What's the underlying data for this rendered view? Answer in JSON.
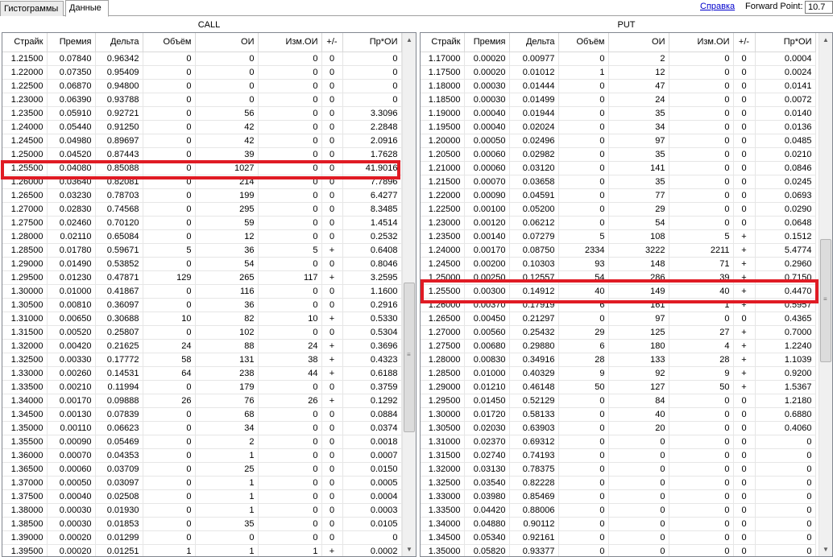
{
  "tabs": [
    {
      "label": "Гистограммы",
      "active": false
    },
    {
      "label": "Данные",
      "active": true
    }
  ],
  "toolbar": {
    "help_link": "Справка",
    "forward_point_label": "Forward Point:",
    "forward_point_value": "10.7"
  },
  "call": {
    "title": "CALL",
    "columns": [
      "Страйк",
      "Премия",
      "Дельта",
      "Объём",
      "ОИ",
      "Изм.ОИ",
      "+/-",
      "Пр*ОИ"
    ],
    "highlighted_strike": "1.25500",
    "rows": [
      [
        "1.21500",
        "0.07840",
        "0.96342",
        "0",
        "0",
        "0",
        "0",
        "0"
      ],
      [
        "1.22000",
        "0.07350",
        "0.95409",
        "0",
        "0",
        "0",
        "0",
        "0"
      ],
      [
        "1.22500",
        "0.06870",
        "0.94800",
        "0",
        "0",
        "0",
        "0",
        "0"
      ],
      [
        "1.23000",
        "0.06390",
        "0.93788",
        "0",
        "0",
        "0",
        "0",
        "0"
      ],
      [
        "1.23500",
        "0.05910",
        "0.92721",
        "0",
        "56",
        "0",
        "0",
        "3.3096"
      ],
      [
        "1.24000",
        "0.05440",
        "0.91250",
        "0",
        "42",
        "0",
        "0",
        "2.2848"
      ],
      [
        "1.24500",
        "0.04980",
        "0.89697",
        "0",
        "42",
        "0",
        "0",
        "2.0916"
      ],
      [
        "1.25000",
        "0.04520",
        "0.87443",
        "0",
        "39",
        "0",
        "0",
        "1.7628"
      ],
      [
        "1.25500",
        "0.04080",
        "0.85088",
        "0",
        "1027",
        "0",
        "0",
        "41.9016"
      ],
      [
        "1.26000",
        "0.03640",
        "0.82081",
        "0",
        "214",
        "0",
        "0",
        "7.7896"
      ],
      [
        "1.26500",
        "0.03230",
        "0.78703",
        "0",
        "199",
        "0",
        "0",
        "6.4277"
      ],
      [
        "1.27000",
        "0.02830",
        "0.74568",
        "0",
        "295",
        "0",
        "0",
        "8.3485"
      ],
      [
        "1.27500",
        "0.02460",
        "0.70120",
        "0",
        "59",
        "0",
        "0",
        "1.4514"
      ],
      [
        "1.28000",
        "0.02110",
        "0.65084",
        "0",
        "12",
        "0",
        "0",
        "0.2532"
      ],
      [
        "1.28500",
        "0.01780",
        "0.59671",
        "5",
        "36",
        "5",
        "+",
        "0.6408"
      ],
      [
        "1.29000",
        "0.01490",
        "0.53852",
        "0",
        "54",
        "0",
        "0",
        "0.8046"
      ],
      [
        "1.29500",
        "0.01230",
        "0.47871",
        "129",
        "265",
        "117",
        "+",
        "3.2595"
      ],
      [
        "1.30000",
        "0.01000",
        "0.41867",
        "0",
        "116",
        "0",
        "0",
        "1.1600"
      ],
      [
        "1.30500",
        "0.00810",
        "0.36097",
        "0",
        "36",
        "0",
        "0",
        "0.2916"
      ],
      [
        "1.31000",
        "0.00650",
        "0.30688",
        "10",
        "82",
        "10",
        "+",
        "0.5330"
      ],
      [
        "1.31500",
        "0.00520",
        "0.25807",
        "0",
        "102",
        "0",
        "0",
        "0.5304"
      ],
      [
        "1.32000",
        "0.00420",
        "0.21625",
        "24",
        "88",
        "24",
        "+",
        "0.3696"
      ],
      [
        "1.32500",
        "0.00330",
        "0.17772",
        "58",
        "131",
        "38",
        "+",
        "0.4323"
      ],
      [
        "1.33000",
        "0.00260",
        "0.14531",
        "64",
        "238",
        "44",
        "+",
        "0.6188"
      ],
      [
        "1.33500",
        "0.00210",
        "0.11994",
        "0",
        "179",
        "0",
        "0",
        "0.3759"
      ],
      [
        "1.34000",
        "0.00170",
        "0.09888",
        "26",
        "76",
        "26",
        "+",
        "0.1292"
      ],
      [
        "1.34500",
        "0.00130",
        "0.07839",
        "0",
        "68",
        "0",
        "0",
        "0.0884"
      ],
      [
        "1.35000",
        "0.00110",
        "0.06623",
        "0",
        "34",
        "0",
        "0",
        "0.0374"
      ],
      [
        "1.35500",
        "0.00090",
        "0.05469",
        "0",
        "2",
        "0",
        "0",
        "0.0018"
      ],
      [
        "1.36000",
        "0.00070",
        "0.04353",
        "0",
        "1",
        "0",
        "0",
        "0.0007"
      ],
      [
        "1.36500",
        "0.00060",
        "0.03709",
        "0",
        "25",
        "0",
        "0",
        "0.0150"
      ],
      [
        "1.37000",
        "0.00050",
        "0.03097",
        "0",
        "1",
        "0",
        "0",
        "0.0005"
      ],
      [
        "1.37500",
        "0.00040",
        "0.02508",
        "0",
        "1",
        "0",
        "0",
        "0.0004"
      ],
      [
        "1.38000",
        "0.00030",
        "0.01930",
        "0",
        "1",
        "0",
        "0",
        "0.0003"
      ],
      [
        "1.38500",
        "0.00030",
        "0.01853",
        "0",
        "35",
        "0",
        "0",
        "0.0105"
      ],
      [
        "1.39000",
        "0.00020",
        "0.01299",
        "0",
        "0",
        "0",
        "0",
        "0"
      ],
      [
        "1.39500",
        "0.00020",
        "0.01251",
        "1",
        "1",
        "1",
        "+",
        "0.0002"
      ]
    ]
  },
  "put": {
    "title": "PUT",
    "columns": [
      "Страйк",
      "Премия",
      "Дельта",
      "Объём",
      "ОИ",
      "Изм.ОИ",
      "+/-",
      "Пр*ОИ"
    ],
    "highlighted_strike": "1.25500",
    "rows": [
      [
        "1.17000",
        "0.00020",
        "0.00977",
        "0",
        "2",
        "0",
        "0",
        "0.0004"
      ],
      [
        "1.17500",
        "0.00020",
        "0.01012",
        "1",
        "12",
        "0",
        "0",
        "0.0024"
      ],
      [
        "1.18000",
        "0.00030",
        "0.01444",
        "0",
        "47",
        "0",
        "0",
        "0.0141"
      ],
      [
        "1.18500",
        "0.00030",
        "0.01499",
        "0",
        "24",
        "0",
        "0",
        "0.0072"
      ],
      [
        "1.19000",
        "0.00040",
        "0.01944",
        "0",
        "35",
        "0",
        "0",
        "0.0140"
      ],
      [
        "1.19500",
        "0.00040",
        "0.02024",
        "0",
        "34",
        "0",
        "0",
        "0.0136"
      ],
      [
        "1.20000",
        "0.00050",
        "0.02496",
        "0",
        "97",
        "0",
        "0",
        "0.0485"
      ],
      [
        "1.20500",
        "0.00060",
        "0.02982",
        "0",
        "35",
        "0",
        "0",
        "0.0210"
      ],
      [
        "1.21000",
        "0.00060",
        "0.03120",
        "0",
        "141",
        "0",
        "0",
        "0.0846"
      ],
      [
        "1.21500",
        "0.00070",
        "0.03658",
        "0",
        "35",
        "0",
        "0",
        "0.0245"
      ],
      [
        "1.22000",
        "0.00090",
        "0.04591",
        "0",
        "77",
        "0",
        "0",
        "0.0693"
      ],
      [
        "1.22500",
        "0.00100",
        "0.05200",
        "0",
        "29",
        "0",
        "0",
        "0.0290"
      ],
      [
        "1.23000",
        "0.00120",
        "0.06212",
        "0",
        "54",
        "0",
        "0",
        "0.0648"
      ],
      [
        "1.23500",
        "0.00140",
        "0.07279",
        "5",
        "108",
        "5",
        "+",
        "0.1512"
      ],
      [
        "1.24000",
        "0.00170",
        "0.08750",
        "2334",
        "3222",
        "2211",
        "+",
        "5.4774"
      ],
      [
        "1.24500",
        "0.00200",
        "0.10303",
        "93",
        "148",
        "71",
        "+",
        "0.2960"
      ],
      [
        "1.25000",
        "0.00250",
        "0.12557",
        "54",
        "286",
        "39",
        "+",
        "0.7150"
      ],
      [
        "1.25500",
        "0.00300",
        "0.14912",
        "40",
        "149",
        "40",
        "+",
        "0.4470"
      ],
      [
        "1.26000",
        "0.00370",
        "0.17919",
        "6",
        "161",
        "1",
        "+",
        "0.5957"
      ],
      [
        "1.26500",
        "0.00450",
        "0.21297",
        "0",
        "97",
        "0",
        "0",
        "0.4365"
      ],
      [
        "1.27000",
        "0.00560",
        "0.25432",
        "29",
        "125",
        "27",
        "+",
        "0.7000"
      ],
      [
        "1.27500",
        "0.00680",
        "0.29880",
        "6",
        "180",
        "4",
        "+",
        "1.2240"
      ],
      [
        "1.28000",
        "0.00830",
        "0.34916",
        "28",
        "133",
        "28",
        "+",
        "1.1039"
      ],
      [
        "1.28500",
        "0.01000",
        "0.40329",
        "9",
        "92",
        "9",
        "+",
        "0.9200"
      ],
      [
        "1.29000",
        "0.01210",
        "0.46148",
        "50",
        "127",
        "50",
        "+",
        "1.5367"
      ],
      [
        "1.29500",
        "0.01450",
        "0.52129",
        "0",
        "84",
        "0",
        "0",
        "1.2180"
      ],
      [
        "1.30000",
        "0.01720",
        "0.58133",
        "0",
        "40",
        "0",
        "0",
        "0.6880"
      ],
      [
        "1.30500",
        "0.02030",
        "0.63903",
        "0",
        "20",
        "0",
        "0",
        "0.4060"
      ],
      [
        "1.31000",
        "0.02370",
        "0.69312",
        "0",
        "0",
        "0",
        "0",
        "0"
      ],
      [
        "1.31500",
        "0.02740",
        "0.74193",
        "0",
        "0",
        "0",
        "0",
        "0"
      ],
      [
        "1.32000",
        "0.03130",
        "0.78375",
        "0",
        "0",
        "0",
        "0",
        "0"
      ],
      [
        "1.32500",
        "0.03540",
        "0.82228",
        "0",
        "0",
        "0",
        "0",
        "0"
      ],
      [
        "1.33000",
        "0.03980",
        "0.85469",
        "0",
        "0",
        "0",
        "0",
        "0"
      ],
      [
        "1.33500",
        "0.04420",
        "0.88006",
        "0",
        "0",
        "0",
        "0",
        "0"
      ],
      [
        "1.34000",
        "0.04880",
        "0.90112",
        "0",
        "0",
        "0",
        "0",
        "0"
      ],
      [
        "1.34500",
        "0.05340",
        "0.92161",
        "0",
        "0",
        "0",
        "0",
        "0"
      ],
      [
        "1.35000",
        "0.05820",
        "0.93377",
        "0",
        "0",
        "0",
        "0",
        "0"
      ]
    ]
  },
  "colors": {
    "highlight": "#e01b24",
    "link": "#0000cc",
    "grid": "#e6e6e6"
  }
}
